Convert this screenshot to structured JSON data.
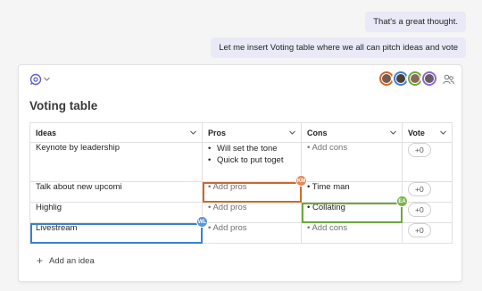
{
  "chat": {
    "messages": [
      {
        "text": "That's a great thought."
      },
      {
        "text": "Let me insert Voting table where we all can pitch ideas and vote"
      }
    ]
  },
  "card": {
    "title": "Voting table",
    "loop_icon": "loop-component-icon",
    "people_icon": "people-icon",
    "avatars": [
      {
        "ring": "#c96a2e",
        "face": "#7a5a4a"
      },
      {
        "ring": "#3a7fd4",
        "face": "#4a4038"
      },
      {
        "ring": "#6ea83a",
        "face": "#8a6a5a"
      },
      {
        "ring": "#8a6ad4",
        "face": "#6a5a6a"
      }
    ]
  },
  "table": {
    "headers": [
      "Ideas",
      "Pros",
      "Cons",
      "Vote"
    ],
    "rows": [
      {
        "idea": "Keynote by leadership",
        "pros": [
          "Will set the tone",
          "Quick to put toget"
        ],
        "cons": "Add cons",
        "vote": "+0"
      },
      {
        "idea": "Talk about new upcomi",
        "pros": "Add pros",
        "cons": "Time man",
        "vote": "+0"
      },
      {
        "idea": "Highlig",
        "pros": "Add pros",
        "cons": "Collating",
        "vote": "+0"
      },
      {
        "idea": "Livestream",
        "pros": "Add pros",
        "cons": "Add cons",
        "vote": "+0"
      }
    ],
    "cursors": {
      "km": "KM",
      "ea": "EA",
      "wl": "WL"
    },
    "add_idea": "Add an idea"
  },
  "colors": {
    "orange": "#c96a2e",
    "green": "#6ea83a",
    "blue": "#3a7fd4",
    "bubble": "#e9e9f7"
  }
}
